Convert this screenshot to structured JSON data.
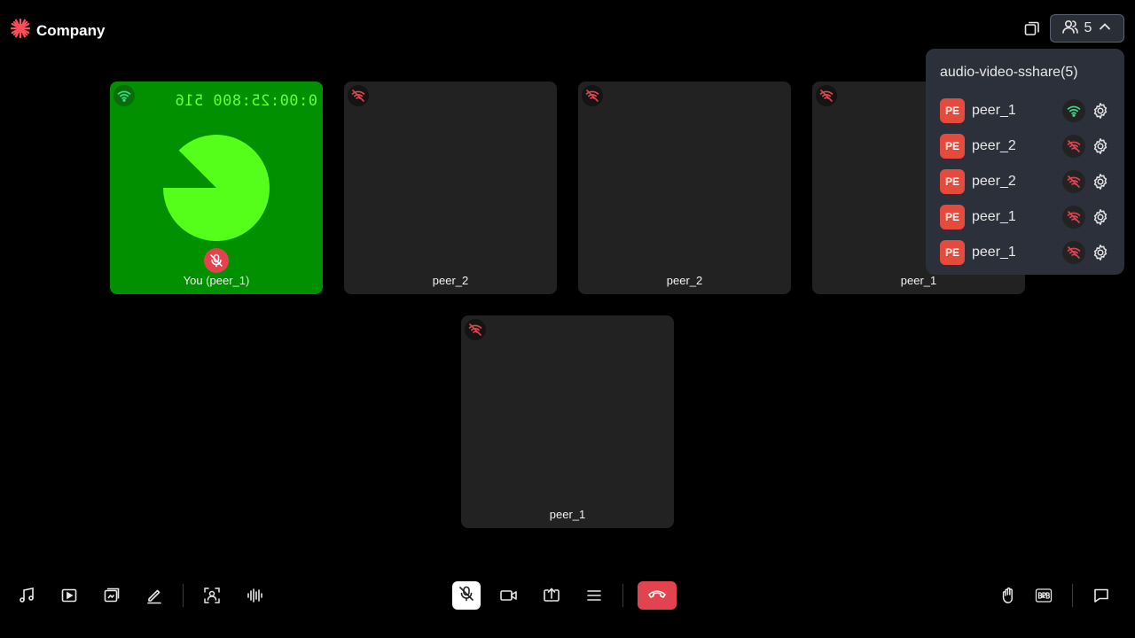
{
  "header": {
    "brand_name": "Company",
    "participant_count": "5"
  },
  "tiles": [
    {
      "name": "You (peer_1)",
      "timecode": "0:00:25:800 516",
      "network": "good",
      "local": true,
      "muted": true
    },
    {
      "name": "peer_2",
      "network": "poor"
    },
    {
      "name": "peer_2",
      "network": "poor"
    },
    {
      "name": "peer_1",
      "network": "poor"
    },
    {
      "name": "peer_1",
      "network": "poor"
    }
  ],
  "participants_panel": {
    "title": "audio-video-sshare(5)",
    "items": [
      {
        "initials": "PE",
        "name": "peer_1",
        "network": "good"
      },
      {
        "initials": "PE",
        "name": "peer_2",
        "network": "poor"
      },
      {
        "initials": "PE",
        "name": "peer_2",
        "network": "poor"
      },
      {
        "initials": "PE",
        "name": "peer_1",
        "network": "poor"
      },
      {
        "initials": "PE",
        "name": "peer_1",
        "network": "poor"
      }
    ]
  },
  "toolbar": {
    "left": [
      "music-icon",
      "play-video-icon",
      "embed-icon",
      "whiteboard-icon",
      "virtual-background-icon",
      "noise-suppression-icon"
    ],
    "center": [
      "mic-off-icon",
      "video-icon",
      "screenshare-icon",
      "more-icon",
      "leave-icon"
    ],
    "right": [
      "hand-raise-icon",
      "brb-icon",
      "chat-icon"
    ]
  },
  "colors": {
    "background": "#000000",
    "tile": "#222222",
    "local_tile": "#009000",
    "accent_red": "#e2434f",
    "network_good": "#3ddc84",
    "network_poor": "#e2434f",
    "panel": "#2c303a"
  }
}
